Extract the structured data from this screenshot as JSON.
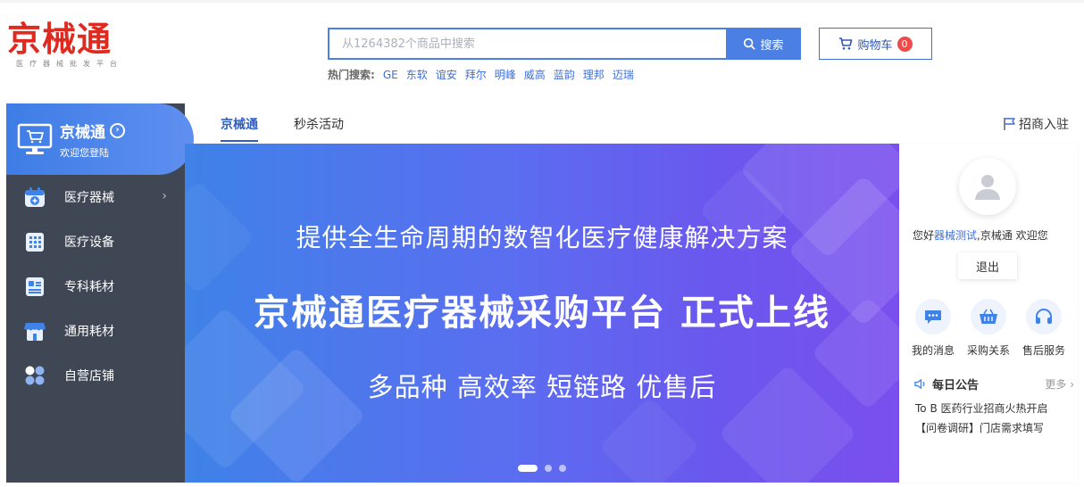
{
  "logo": {
    "title": "京械通",
    "subtitle": "医疗器械批发平台"
  },
  "search": {
    "placeholder": "从1264382个商品中搜索",
    "value": "",
    "button_label": "搜索"
  },
  "hot_search": {
    "label": "热门搜索:",
    "items": [
      "GE",
      "东软",
      "谊安",
      "拜尔",
      "明峰",
      "威高",
      "蓝韵",
      "理邦",
      "迈瑞"
    ]
  },
  "cart": {
    "label": "购物车",
    "count": "0"
  },
  "sidebar": {
    "title": "京械通",
    "subtitle": "欢迎您登陆",
    "items": [
      {
        "label": "医疗器械",
        "icon": "medical-kit-icon"
      },
      {
        "label": "医疗设备",
        "icon": "building-icon"
      },
      {
        "label": "专科耗材",
        "icon": "document-icon"
      },
      {
        "label": "通用耗材",
        "icon": "store-icon"
      },
      {
        "label": "自营店铺",
        "icon": "dots-grid-icon"
      }
    ]
  },
  "tabs": {
    "items": [
      "京械通",
      "秒杀活动"
    ],
    "active": 0
  },
  "invite": {
    "label": "招商入驻"
  },
  "banner": {
    "line1": "提供全生命周期的数智化医疗健康解决方案",
    "line2": "京械通医疗器械采购平台 正式上线",
    "line3": "多品种 高效率 短链路 优售后",
    "slide_count": 3,
    "active_slide": 1
  },
  "user_panel": {
    "greet_prefix": "您好",
    "username": "器械测试",
    "greet_suffix": ",京械通 欢迎您",
    "logout_label": "退出"
  },
  "quick_links": [
    {
      "label": "我的消息",
      "icon": "message-icon"
    },
    {
      "label": "采购关系",
      "icon": "basket-icon"
    },
    {
      "label": "售后服务",
      "icon": "headset-icon"
    }
  ],
  "notice": {
    "title": "每日公告",
    "more_label": "更多 ›",
    "items": [
      "To B 医药行业招商火热开启",
      "【问卷调研】门店需求填写"
    ]
  },
  "colors": {
    "brand_red": "#e02a1f",
    "primary_blue": "#4b7fe4",
    "sidebar_bg": "#3f4654"
  }
}
